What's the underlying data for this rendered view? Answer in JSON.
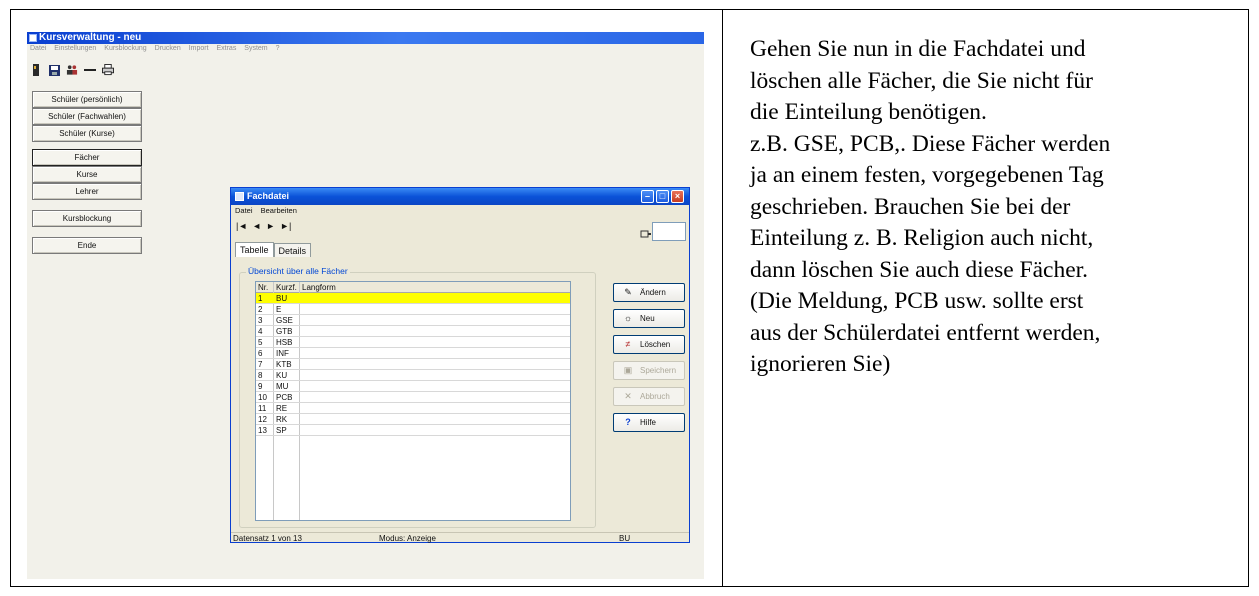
{
  "document": {
    "paragraph": [
      "Gehen Sie nun in die Fachdatei und",
      "löschen alle Fächer, die Sie nicht für",
      "die Einteilung benötigen.",
      "z.B. GSE, PCB,. Diese Fächer werden",
      "ja an einem festen, vorgegebenen Tag",
      "geschrieben. Brauchen Sie bei der",
      "Einteilung z. B. Religion auch nicht,",
      "dann löschen Sie auch diese Fächer.",
      "(Die Meldung, PCB usw. sollte erst",
      "aus der Schülerdatei entfernt werden,",
      "ignorieren Sie)"
    ]
  },
  "app": {
    "title": "Kursverwaltung - neu",
    "menu": [
      "Datei",
      "Einstellungen",
      "Kursblockung",
      "Drucken",
      "Import",
      "Extras",
      "System",
      "?"
    ],
    "sidebar": [
      {
        "label": "Schüler (persönlich)",
        "active": false
      },
      {
        "label": "Schüler (Fachwahlen)",
        "active": false
      },
      {
        "label": "Schüler (Kurse)",
        "active": false
      },
      {
        "label": "Fächer",
        "active": true
      },
      {
        "label": "Kurse",
        "active": false
      },
      {
        "label": "Lehrer",
        "active": false
      },
      {
        "label": "Kursblockung",
        "active": false
      },
      {
        "label": "Ende",
        "active": false
      }
    ]
  },
  "fachdatei": {
    "title": "Fachdatei",
    "menu": [
      "Datei",
      "Bearbeiten"
    ],
    "nav": [
      "|◄",
      "◄",
      "►",
      "►|"
    ],
    "tabs": [
      "Tabelle",
      "Details"
    ],
    "group_label": "Übersicht über alle Fächer",
    "columns": [
      "Nr.",
      "Kurzf.",
      "Langform"
    ],
    "rows": [
      {
        "nr": "1",
        "kurz": "BU",
        "lang": ""
      },
      {
        "nr": "2",
        "kurz": "E",
        "lang": ""
      },
      {
        "nr": "3",
        "kurz": "GSE",
        "lang": ""
      },
      {
        "nr": "4",
        "kurz": "GTB",
        "lang": ""
      },
      {
        "nr": "5",
        "kurz": "HSB",
        "lang": ""
      },
      {
        "nr": "6",
        "kurz": "INF",
        "lang": ""
      },
      {
        "nr": "7",
        "kurz": "KTB",
        "lang": ""
      },
      {
        "nr": "8",
        "kurz": "KU",
        "lang": ""
      },
      {
        "nr": "9",
        "kurz": "MU",
        "lang": ""
      },
      {
        "nr": "10",
        "kurz": "PCB",
        "lang": ""
      },
      {
        "nr": "11",
        "kurz": "RE",
        "lang": ""
      },
      {
        "nr": "12",
        "kurz": "RK",
        "lang": ""
      },
      {
        "nr": "13",
        "kurz": "SP",
        "lang": ""
      }
    ],
    "selected_row": 1,
    "buttons": {
      "aendern": "Ändern",
      "neu": "Neu",
      "loeschen": "Löschen",
      "speichern": "Speichern",
      "abbruch": "Abbruch",
      "hilfe": "Hilfe"
    },
    "status": {
      "record": "Datensatz 1 von 13",
      "mode": "Modus: Anzeige",
      "current": "BU"
    },
    "selection_color": "#ffff00"
  }
}
